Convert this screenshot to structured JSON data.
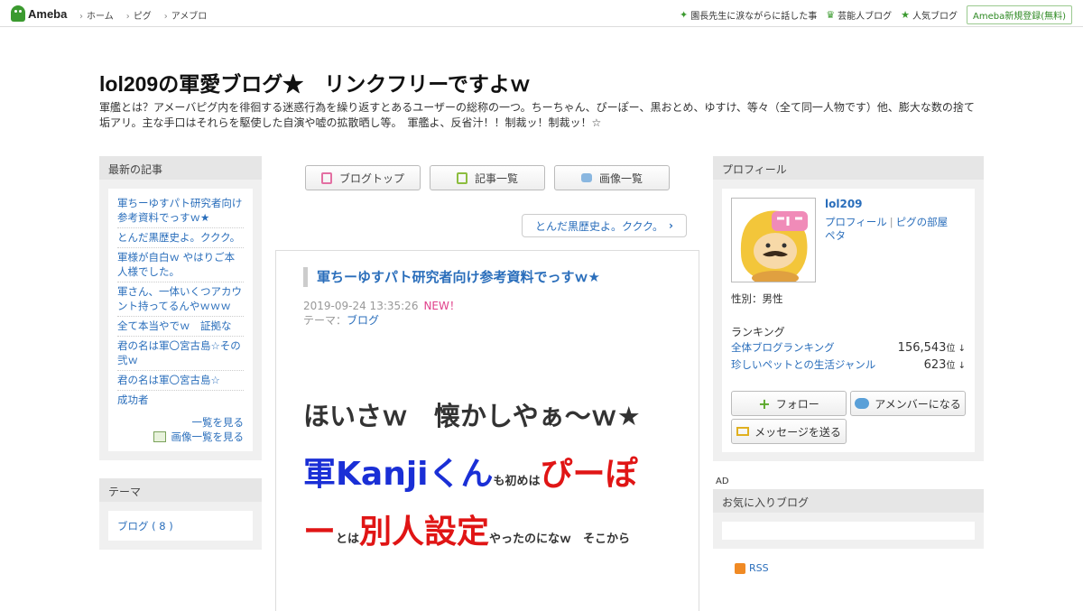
{
  "topbar": {
    "logo": "Ameba",
    "nav": [
      "ホーム",
      "ピグ",
      "アメブロ"
    ],
    "right_links": [
      "園長先生に涙ながらに話した事",
      "芸能人ブログ",
      "人気ブログ"
    ],
    "signup": "Ameba新規登録(無料)"
  },
  "header": {
    "title": "lol209の軍愛ブログ★　リンクフリーですよｗ",
    "description": "軍艦とは？アメーバピグ内を徘徊する迷惑行為を繰り返すとあるユーザーの総称の一つ。ちーちゃん、ぴーぽー、黒おとめ、ゆすけ、等々（全て同一人物です）他、膨大な数の捨て垢アリ。主な手口はそれらを駆使した自演や嘘の拡散晒し等。　軍艦よ、反省汁！！制裁ッ！制裁ッ！☆"
  },
  "left": {
    "recent_heading": "最新の記事",
    "recent": [
      "軍ちーゆすパト研究者向け参考資料でっすｗ★",
      "とんだ黒歴史よ。ククク。",
      "軍様が自白ｗ やはりご本人様でした。",
      "軍さん、一体いくつアカウント持ってるんやｗｗｗ",
      "全て本当やでｗ　証拠な",
      "君の名は軍〇宮古島☆その弐ｗ",
      "君の名は軍〇宮古島☆",
      "成功者"
    ],
    "more": "一覧を見る",
    "more_images": "画像一覧を見る",
    "theme_heading": "テーマ",
    "theme_item": "ブログ ( 8 )"
  },
  "center": {
    "tabs": [
      "ブログトップ",
      "記事一覧",
      "画像一覧"
    ],
    "next": "とんだ黒歴史よ。ククク。",
    "article": {
      "title": "軍ちーゆすパト研究者向け参考資料でっすｗ★",
      "date": "2019-09-24 13:35:26",
      "new_badge": "NEW！",
      "theme_label": "テーマ：",
      "theme": "ブログ",
      "line1": "ほいさｗ　懐かしやぁ～ｗ★",
      "seg_a": "軍Kanjiくん",
      "seg_b": "も初めは",
      "seg_c": "ぴーぽ",
      "seg_d": "ー",
      "seg_e": "とは",
      "seg_f": "別人設定",
      "seg_g": "やったのになｗ　そこから"
    }
  },
  "right": {
    "profile_heading": "プロフィール",
    "name": "lol209",
    "links": [
      "プロフィール",
      "ピグの部屋"
    ],
    "extra_link": "ペタ",
    "gender": "性別：男性",
    "ranking_heading": "ランキング",
    "rankings": [
      {
        "label": "全体ブログランキング",
        "value": "156,543",
        "suffix": "位 ↓"
      },
      {
        "label": "珍しいペットとの生活ジャンル",
        "value": "623",
        "suffix": "位 ↓"
      }
    ],
    "follow": "フォロー",
    "amember": "アメンバーになる",
    "message": "メッセージを送る",
    "ad": "AD",
    "fav_heading": "お気に入りブログ",
    "rss": "RSS"
  },
  "colors": {
    "link": "#2a6ebb",
    "accent_green": "#3b9a2f",
    "new": "#e0408a",
    "red": "#e01515",
    "blue": "#1a2fd6"
  }
}
